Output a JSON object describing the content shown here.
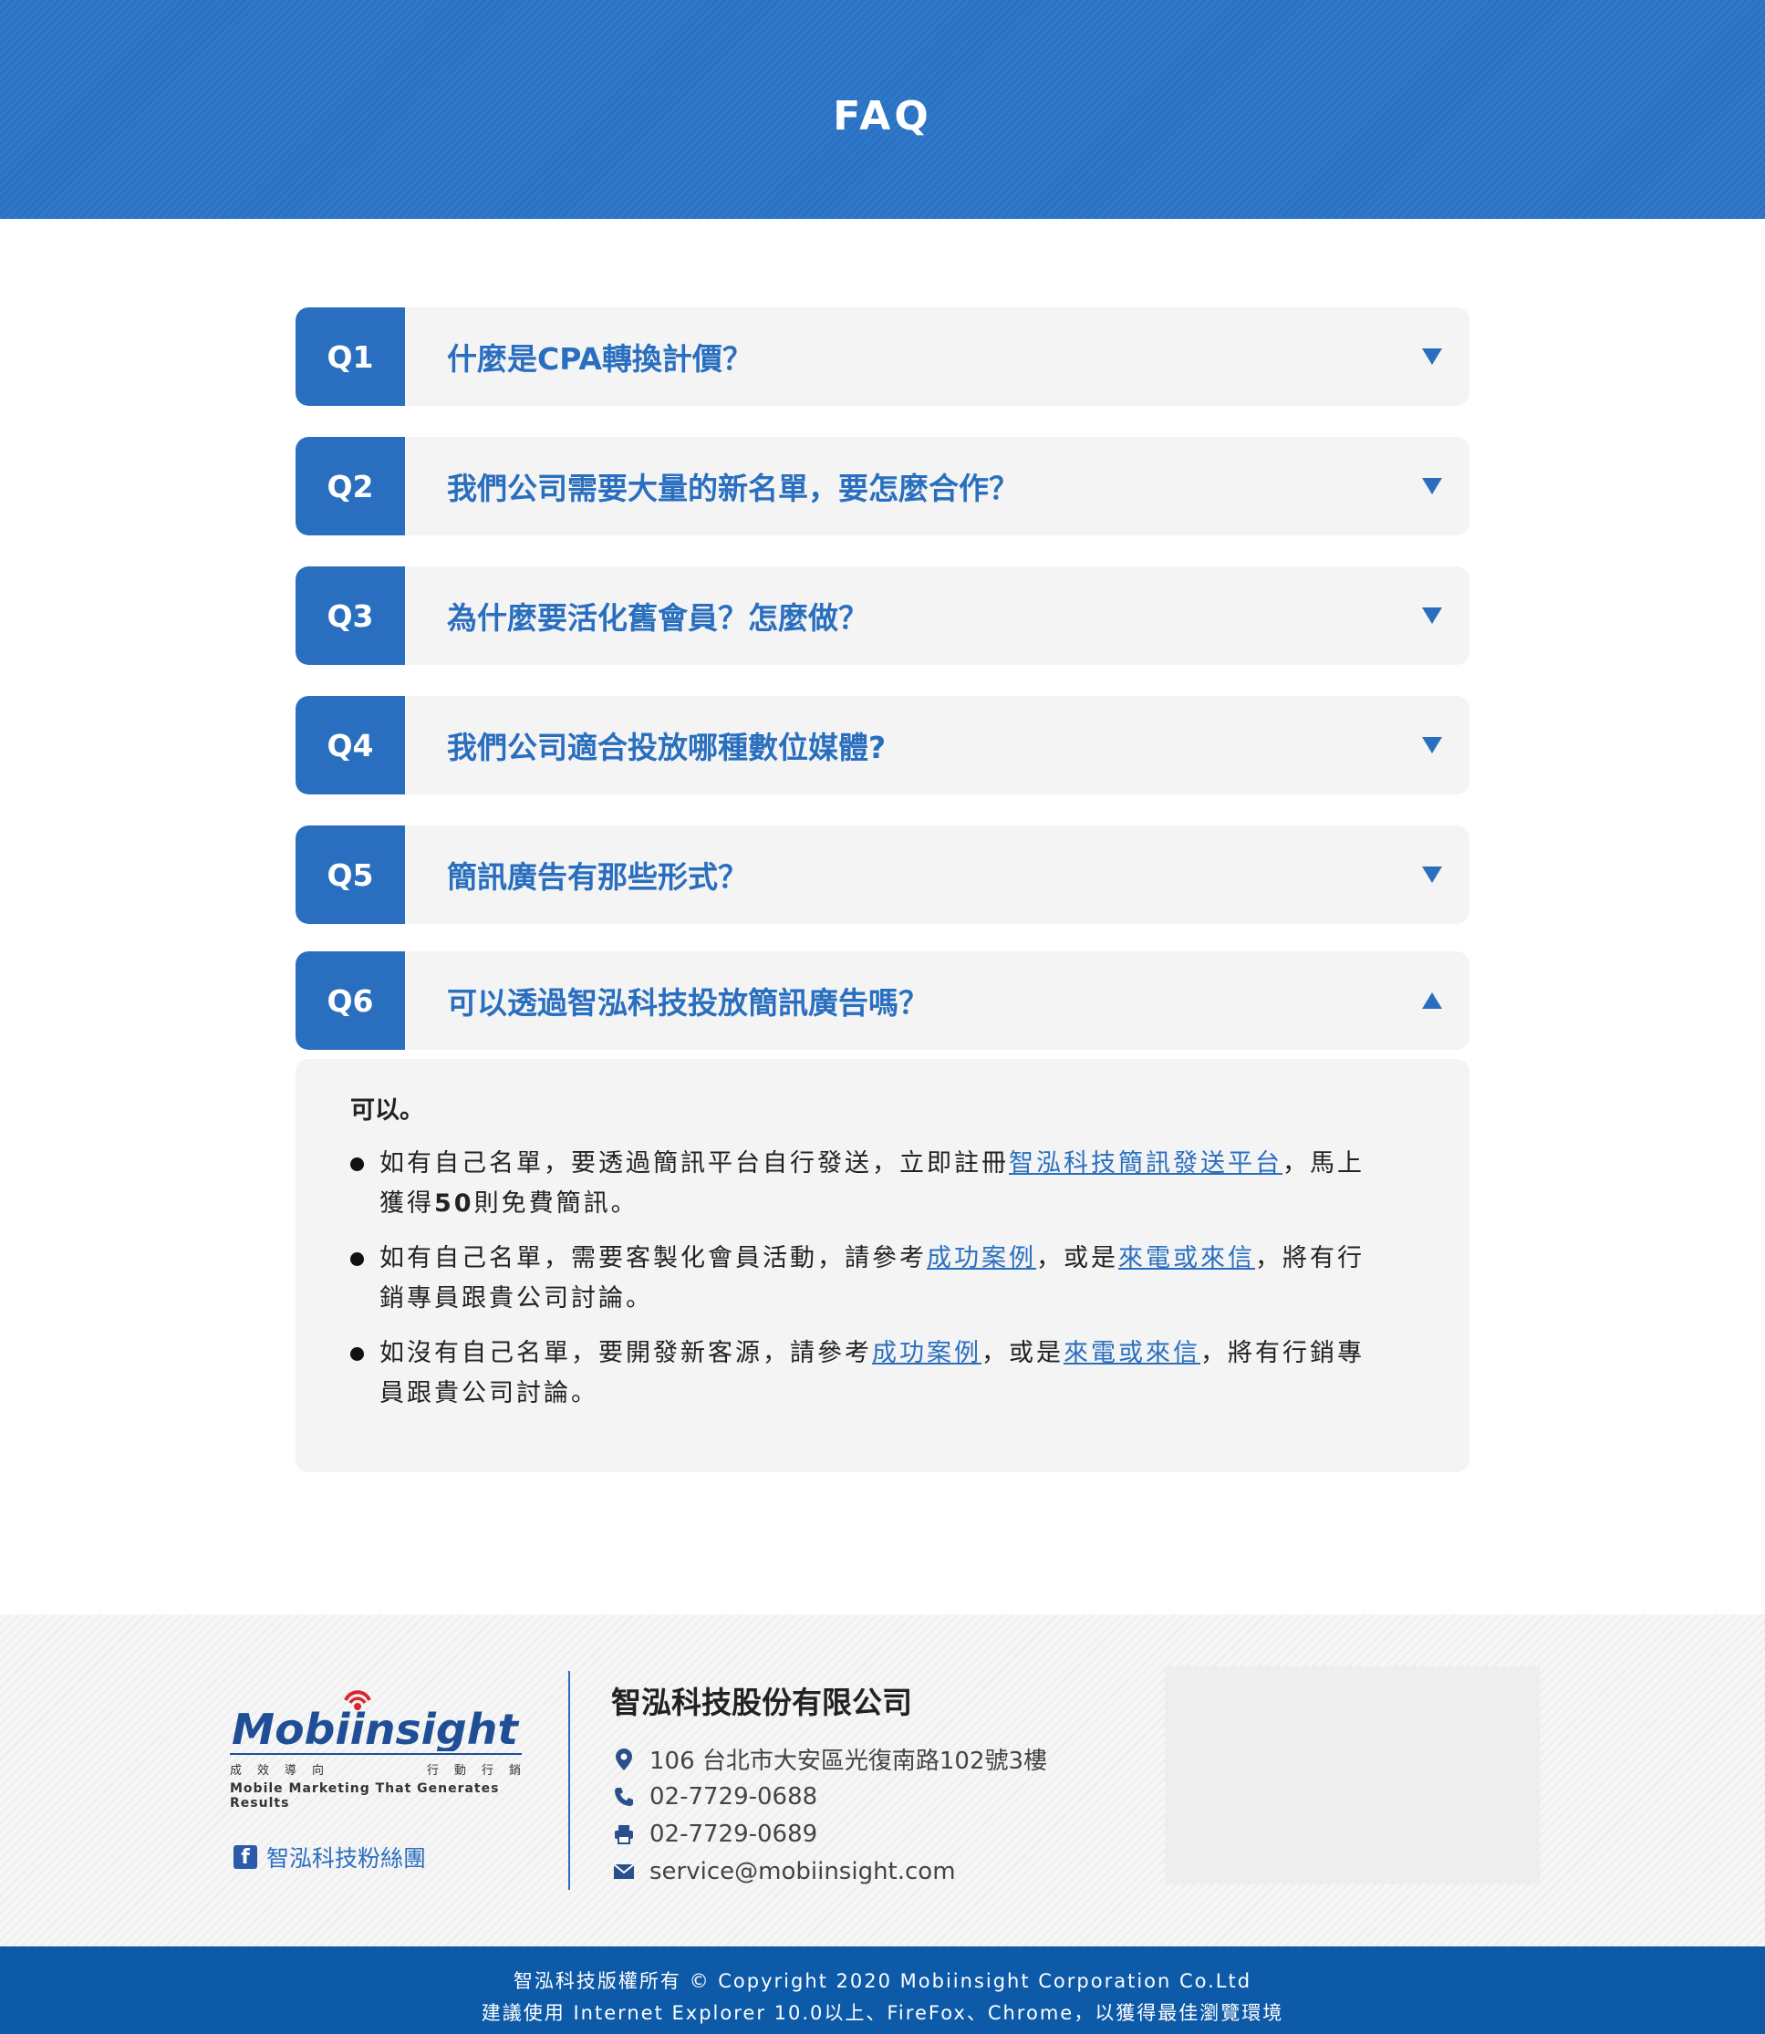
{
  "header": {
    "title": "FAQ"
  },
  "faq": {
    "items": [
      {
        "num": "Q1",
        "question": "什麼是CPA轉換計價？",
        "open": false
      },
      {
        "num": "Q2",
        "question": "我們公司需要大量的新名單，要怎麼合作？",
        "open": false
      },
      {
        "num": "Q3",
        "question": "為什麼要活化舊會員？怎麼做？",
        "open": false
      },
      {
        "num": "Q4",
        "question": "我們公司適合投放哪種數位媒體?",
        "open": false
      },
      {
        "num": "Q5",
        "question": "簡訊廣告有那些形式？",
        "open": false
      },
      {
        "num": "Q6",
        "question": "可以透過智泓科技投放簡訊廣告嗎？",
        "open": true
      }
    ],
    "answer": {
      "lead": "可以。",
      "b1": {
        "pre": "如有自己名單，要透過簡訊平台自行發送，立即註冊",
        "link": "智泓科技簡訊發送平台",
        "mid": "，馬上獲得",
        "bold": "50",
        "post": "則免費簡訊。"
      },
      "b2": {
        "pre": "如有自己名單，需要客製化會員活動，請參考",
        "link1": "成功案例",
        "mid": "，或是",
        "link2": "來電或來信",
        "post": "，將有行銷專員跟貴公司討論。"
      },
      "b3": {
        "pre": "如沒有自己名單，要開發新客源，請參考",
        "link1": "成功案例",
        "mid": "，或是",
        "link2": "來電或來信",
        "post": "，將有行銷專員跟貴公司討論。"
      }
    }
  },
  "footer": {
    "logo": {
      "brand": "Mobiinsight",
      "tag_left": [
        "成",
        "效",
        "導",
        "向"
      ],
      "tag_right": [
        "行",
        "動",
        "行",
        "銷"
      ],
      "tagline_en": "Mobile Marketing That Generates Results"
    },
    "facebook_label": "智泓科技粉絲團",
    "company_name": "智泓科技股份有限公司",
    "address": "106 台北市大安區光復南路102號3樓",
    "phone": "02-7729-0688",
    "fax": "02-7729-0689",
    "email": "service@mobiinsight.com",
    "icons": [
      "map-pin-icon",
      "phone-icon",
      "fax-icon",
      "mail-icon"
    ]
  },
  "copyright": {
    "line1": "智泓科技版權所有 © Copyright 2020 Mobiinsight Corporation Co.Ltd",
    "line2": "建議使用 Internet Explorer 10.0以上、FireFox、Chrome，以獲得最佳瀏覽環境"
  },
  "colors": {
    "brand": "#2a6fbf",
    "banner": "#2a73c4",
    "copyright_bg": "#0d5aa8",
    "card_bg": "#f4f4f4"
  }
}
